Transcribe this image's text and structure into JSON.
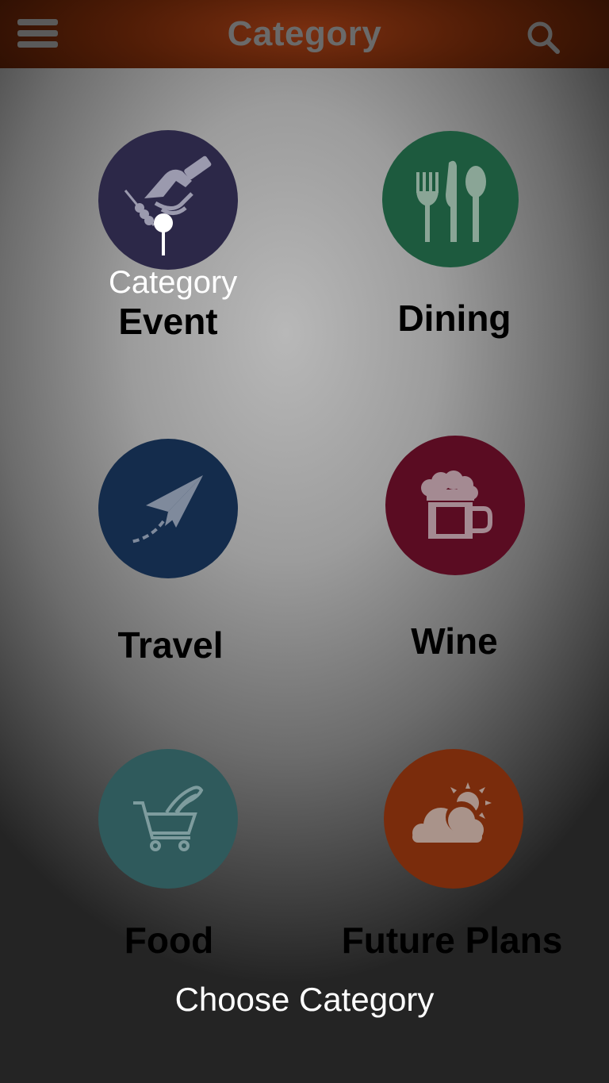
{
  "header": {
    "title": "Category",
    "menu_icon": "hamburger-menu-icon",
    "search_icon": "search-icon"
  },
  "categories": [
    {
      "label": "Event",
      "icon": "handshake-icon",
      "color": "#2c2848"
    },
    {
      "label": "Dining",
      "icon": "fork-knife-spoon-icon",
      "color": "#1d5a3e"
    },
    {
      "label": "Travel",
      "icon": "paper-plane-icon",
      "color": "#142c4c"
    },
    {
      "label": "Wine",
      "icon": "beer-mug-icon",
      "color": "#5a0c22"
    },
    {
      "label": "Food",
      "icon": "shopping-cart-icon",
      "color": "#2f5a5c"
    },
    {
      "label": "Future Plans",
      "icon": "sun-cloud-icon",
      "color": "#7a2c0c"
    }
  ],
  "tutorial": {
    "tooltip": "Category",
    "hint": "Choose Category"
  }
}
